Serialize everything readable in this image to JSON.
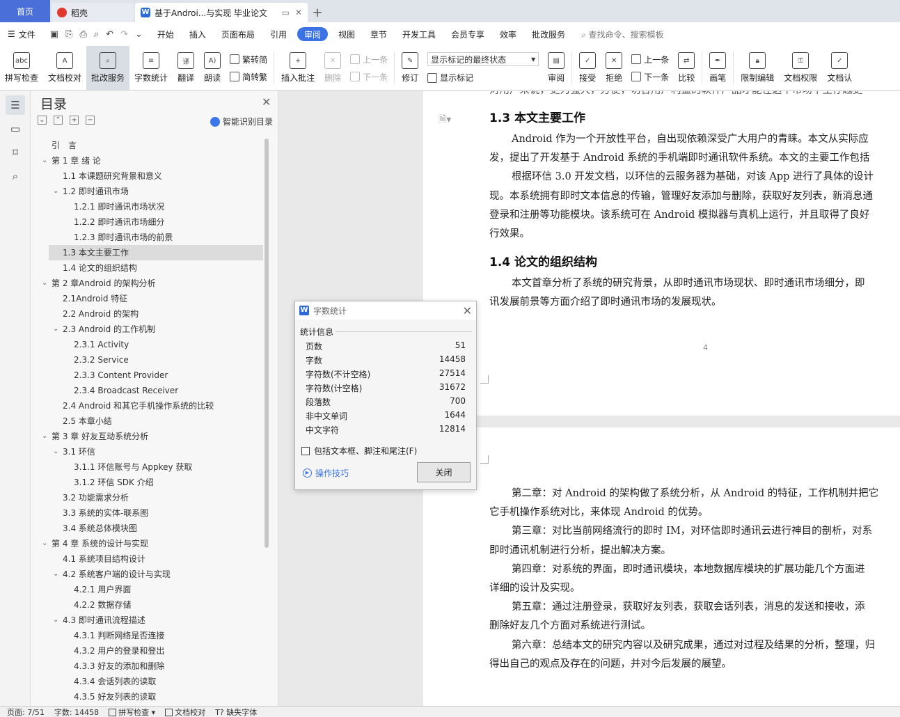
{
  "tabs": {
    "home": "首页",
    "daoke": "稻壳",
    "doc": "基于Androi...与实现 毕业论文"
  },
  "menu": {
    "file": "文件",
    "items": [
      "开始",
      "插入",
      "页面布局",
      "引用",
      "审阅",
      "视图",
      "章节",
      "开发工具",
      "会员专享",
      "效率",
      "批改服务"
    ],
    "active_index": 4,
    "search": "查找命令、搜索模板"
  },
  "ribbon": {
    "spell": "拼写检查",
    "spell_icon_text": "abc",
    "doc_check": "文档校对",
    "grading": "批改服务",
    "word_count": "字数统计",
    "translate": "翻译",
    "read": "朗读",
    "to_traditional": "繁转简",
    "to_simplified": "简转繁",
    "insert_comment": "插入批注",
    "delete": "删除",
    "prev": "上一条",
    "next": "下一条",
    "revise": "修订",
    "markup_state": "显示标记的最终状态",
    "show_markup": "显示标记",
    "review": "审阅",
    "accept": "接受",
    "reject": "拒绝",
    "prev2": "上一条",
    "next2": "下一条",
    "compare": "比较",
    "pen": "画笔",
    "restrict": "限制编辑",
    "doc_perm": "文档权限",
    "doc_cert": "文档认"
  },
  "toc": {
    "title": "目录",
    "smart": "智能识别目录",
    "items": [
      {
        "text": "引　言",
        "level": 0,
        "caret": ""
      },
      {
        "text": "第 1 章  绪  论",
        "level": 0,
        "caret": "v"
      },
      {
        "text": "1.1 本课题研究背景和意义",
        "level": 1,
        "caret": ""
      },
      {
        "text": "1.2 即时通讯市场",
        "level": 1,
        "caret": "v"
      },
      {
        "text": "1.2.1  即时通讯市场状况",
        "level": 2,
        "caret": ""
      },
      {
        "text": "1.2.2  即时通讯市场细分",
        "level": 2,
        "caret": ""
      },
      {
        "text": "1.2.3  即时通讯市场的前景",
        "level": 2,
        "caret": ""
      },
      {
        "text": "1.3 本文主要工作",
        "level": 1,
        "caret": "",
        "selected": true
      },
      {
        "text": "1.4 论文的组织结构",
        "level": 1,
        "caret": ""
      },
      {
        "text": "第 2 章Android 的架构分析",
        "level": 0,
        "caret": "v"
      },
      {
        "text": "2.1Android 特征",
        "level": 1,
        "caret": ""
      },
      {
        "text": "2.2 Android 的架构",
        "level": 1,
        "caret": ""
      },
      {
        "text": "2.3 Android 的工作机制",
        "level": 1,
        "caret": "v"
      },
      {
        "text": "2.3.1 Activity",
        "level": 2,
        "caret": ""
      },
      {
        "text": "2.3.2 Service",
        "level": 2,
        "caret": ""
      },
      {
        "text": "2.3.3 Content Provider",
        "level": 2,
        "caret": ""
      },
      {
        "text": "2.3.4 Broadcast Receiver",
        "level": 2,
        "caret": ""
      },
      {
        "text": "2.4 Android 和其它手机操作系统的比较",
        "level": 1,
        "caret": ""
      },
      {
        "text": "2.5 本章小结",
        "level": 1,
        "caret": ""
      },
      {
        "text": "第 3 章  好友互动系统分析",
        "level": 0,
        "caret": "v"
      },
      {
        "text": "3.1 环信",
        "level": 1,
        "caret": "v"
      },
      {
        "text": "3.1.1 环信账号与 Appkey 获取",
        "level": 2,
        "caret": ""
      },
      {
        "text": "3.1.2  环信  SDK 介绍",
        "level": 2,
        "caret": ""
      },
      {
        "text": "3.2 功能需求分析",
        "level": 1,
        "caret": ""
      },
      {
        "text": "3.3 系统的实体-联系图",
        "level": 1,
        "caret": ""
      },
      {
        "text": "3.4 系统总体模块图",
        "level": 1,
        "caret": ""
      },
      {
        "text": "第 4 章  系统的设计与实现",
        "level": 0,
        "caret": "v"
      },
      {
        "text": "4.1  系统项目结构设计",
        "level": 1,
        "caret": ""
      },
      {
        "text": "4.2  系统客户端的设计与实现",
        "level": 1,
        "caret": "v"
      },
      {
        "text": "4.2.1 用户界面",
        "level": 2,
        "caret": ""
      },
      {
        "text": "4.2.2  数据存储",
        "level": 2,
        "caret": ""
      },
      {
        "text": "4.3 即时通讯流程描述",
        "level": 1,
        "caret": "v"
      },
      {
        "text": "4.3.1 判断网络是否连接",
        "level": 2,
        "caret": ""
      },
      {
        "text": "4.3.2 用户的登录和登出",
        "level": 2,
        "caret": ""
      },
      {
        "text": "4.3.3 好友的添加和删除",
        "level": 2,
        "caret": ""
      },
      {
        "text": "4.3.4 会话列表的读取",
        "level": 2,
        "caret": ""
      },
      {
        "text": "4.3.5 好友列表的读取",
        "level": 2,
        "caret": ""
      }
    ]
  },
  "doc": {
    "top_cut": "对用户来说，更为强大，方便，切合用户利益的软件产品才能在这个市场中生存越更",
    "h13": "1.3 本文主要工作",
    "p1": [
      "Android 作为一个开放性平台，自出现依赖深受广大用户的青睐。本文从实际应",
      "发，提出了开发基于  Android 系统的手机端即时通讯软件系统。本文的主要工作包括",
      "根据环信  3.0  开发文档，以环信的云服务器为基础，对该 App 进行了具体的设计",
      "现。本系统拥有即时文本信息的传输，管理好友添加与删除，获取好友列表，新消息通",
      "登录和注册等功能模块。该系统可在  Android 模拟器与真机上运行，并且取得了良好",
      "行效果。"
    ],
    "h14": "1.4 论文的组织结构",
    "p2": [
      "本文首章分析了系统的研究背景，从即时通讯市场现状、即时通讯市场细分，即",
      "讯发展前景等方面介绍了即时通讯市场的发展现状。"
    ],
    "page_number": "4",
    "p3": [
      "第二章：对 Android 的架构做了系统分析，从 Android 的特征，工作机制并把它",
      "它手机操作系统对比，来体现 Android 的优势。",
      "第三章：对比当前网络流行的即时 IM，对环信即时通讯云进行神目的剖析，对系",
      "即时通讯机制进行分析，提出解决方案。",
      "第四章：对系统的界面，即时通讯模块，本地数据库模块的扩展功能几个方面进",
      "详细的设计及实现。",
      "第五章：通过注册登录，获取好友列表，获取会话列表，消息的发送和接收，添",
      "删除好友几个方面对系统进行测试。",
      "第六章：总结本文的研究内容以及研究成果，通过对过程及结果的分析，整理，归",
      "得出自己的观点及存在的问题，并对今后发展的展望。"
    ]
  },
  "dialog": {
    "title": "字数统计",
    "section": "统计信息",
    "stats": [
      {
        "label": "页数",
        "value": "51"
      },
      {
        "label": "字数",
        "value": "14458"
      },
      {
        "label": "字符数(不计空格)",
        "value": "27514"
      },
      {
        "label": "字符数(计空格)",
        "value": "31672"
      },
      {
        "label": "段落数",
        "value": "700"
      },
      {
        "label": "非中文单词",
        "value": "1644"
      },
      {
        "label": "中文字符",
        "value": "12814"
      }
    ],
    "checkbox": "包括文本框、脚注和尾注(F)",
    "tips": "操作技巧",
    "close": "关闭"
  },
  "status": {
    "page": "页面: 7/51",
    "words": "字数: 14458",
    "spell": "拼写检查",
    "doc_check": "文档校对",
    "missing_font": "缺失字体"
  }
}
